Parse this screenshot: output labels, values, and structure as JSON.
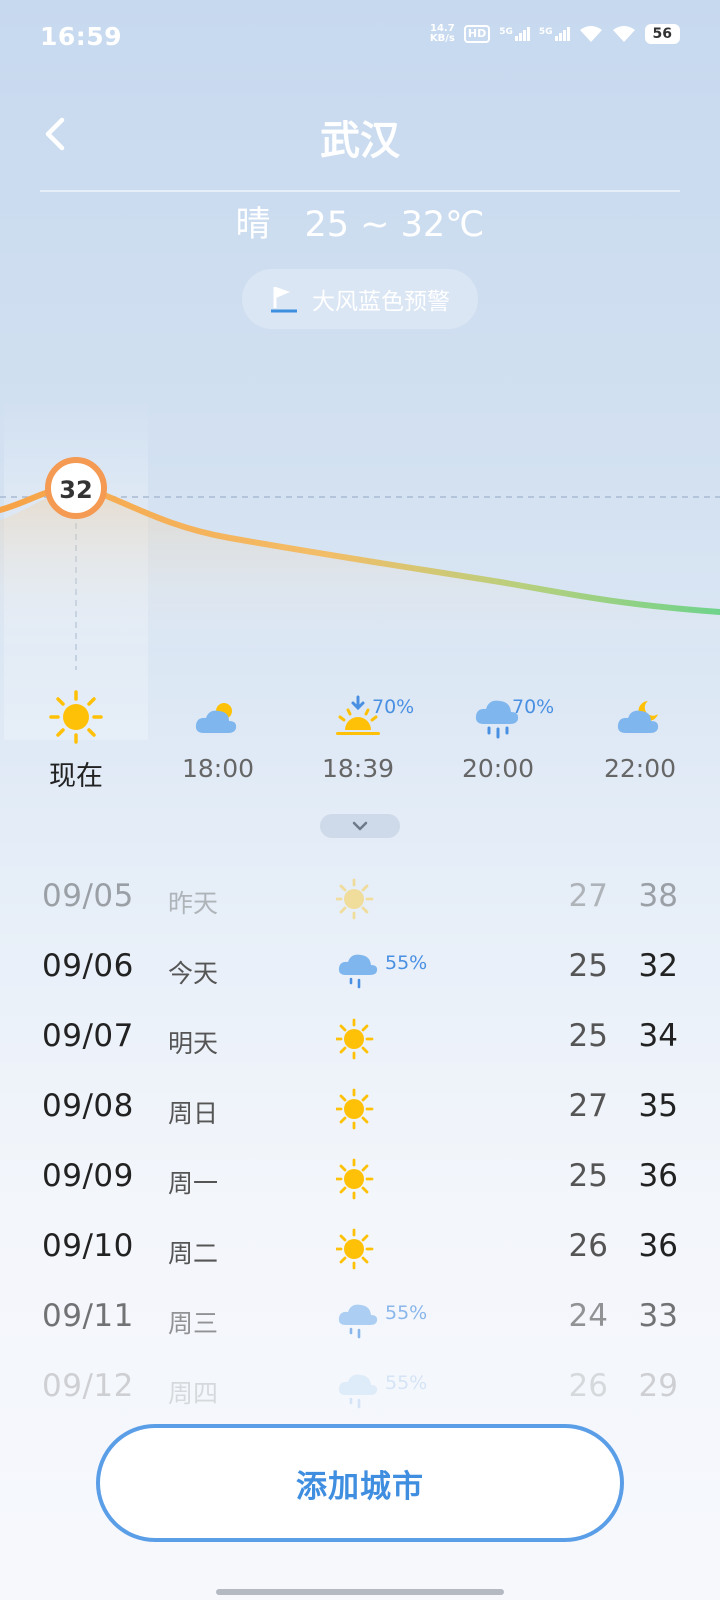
{
  "status_bar": {
    "time": "16:59",
    "net_speed_value": "14.7",
    "net_speed_unit": "KB/s",
    "hd": "HD",
    "sim1_label": "5G",
    "sim2_label": "5G",
    "battery": "56"
  },
  "header": {
    "city": "武汉",
    "condition": "晴",
    "temp_range": "25 ~ 32℃",
    "alert": "大风蓝色预警"
  },
  "chart_data": {
    "type": "line",
    "current_temp_label": "32",
    "current_temp": 32,
    "colors": {
      "warm": "#f7a347",
      "cool": "#79d18d",
      "marker_border": "#f49a52"
    }
  },
  "hourly": [
    {
      "label": "现在",
      "icon": "sun-icon",
      "precip": ""
    },
    {
      "label": "18:00",
      "icon": "partly-cloudy-icon",
      "precip": ""
    },
    {
      "label": "18:39",
      "icon": "sunset-icon",
      "precip": "70%"
    },
    {
      "label": "20:00",
      "icon": "rain-cloud-icon",
      "precip": "70%"
    },
    {
      "label": "22:00",
      "icon": "cloudy-night-icon",
      "precip": ""
    }
  ],
  "daily": [
    {
      "date": "09/05",
      "day": "昨天",
      "icon": "sun-icon",
      "precip": "",
      "low": "27",
      "high": "38"
    },
    {
      "date": "09/06",
      "day": "今天",
      "icon": "rain-cloud-icon",
      "precip": "55%",
      "low": "25",
      "high": "32"
    },
    {
      "date": "09/07",
      "day": "明天",
      "icon": "sun-icon",
      "precip": "",
      "low": "25",
      "high": "34"
    },
    {
      "date": "09/08",
      "day": "周日",
      "icon": "sun-icon",
      "precip": "",
      "low": "27",
      "high": "35"
    },
    {
      "date": "09/09",
      "day": "周一",
      "icon": "sun-icon",
      "precip": "",
      "low": "25",
      "high": "36"
    },
    {
      "date": "09/10",
      "day": "周二",
      "icon": "sun-icon",
      "precip": "",
      "low": "26",
      "high": "36"
    },
    {
      "date": "09/11",
      "day": "周三",
      "icon": "rain-cloud-icon",
      "precip": "55%",
      "low": "24",
      "high": "33"
    },
    {
      "date": "09/12",
      "day": "周四",
      "icon": "rain-cloud-icon",
      "precip": "55%",
      "low": "26",
      "high": "29"
    }
  ],
  "add_city": {
    "label": "添加城市"
  },
  "theme": {
    "accent": "#4a90e2",
    "sun": "#ffc107",
    "cloud": "#7fb6ee"
  }
}
